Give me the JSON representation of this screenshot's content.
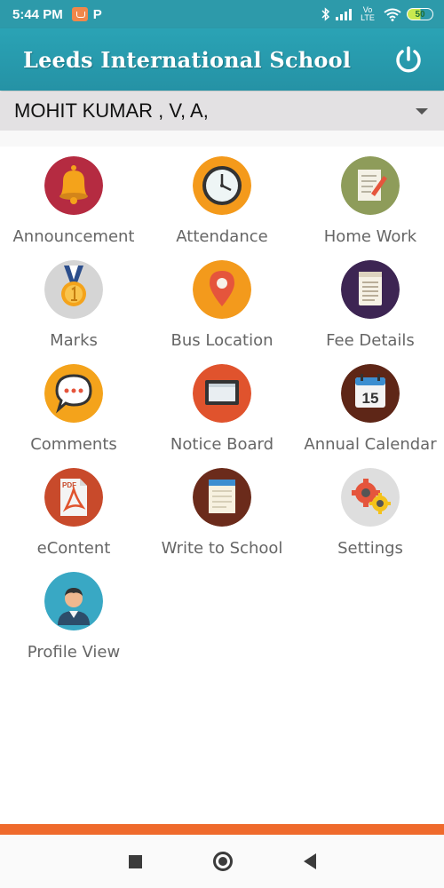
{
  "status_bar": {
    "time": "5:44 PM",
    "app_badge": "P",
    "network": "Vo LTE",
    "battery": "50"
  },
  "header": {
    "title": "Leeds International School",
    "power_icon": "power-icon",
    "background_color": "#2aa3b5"
  },
  "student": {
    "name": "MOHIT KUMAR , V, A,"
  },
  "menu": [
    {
      "label": "Announcement",
      "icon": "bell-icon",
      "color": "#b52b41"
    },
    {
      "label": "Attendance",
      "icon": "clock-icon",
      "color": "#f49a1b"
    },
    {
      "label": "Home Work",
      "icon": "notepad-icon",
      "color": "#8e9c5a"
    },
    {
      "label": "Marks",
      "icon": "medal-icon",
      "color": "#d5d5d5"
    },
    {
      "label": "Bus Location",
      "icon": "map-pin-icon",
      "color": "#f39a1c"
    },
    {
      "label": "Fee Details",
      "icon": "document-icon",
      "color": "#3d2553"
    },
    {
      "label": "Comments",
      "icon": "speech-bubble-icon",
      "color": "#f4a31b"
    },
    {
      "label": "Notice Board",
      "icon": "board-icon",
      "color": "#e0532d"
    },
    {
      "label": "Annual Calendar",
      "icon": "calendar-icon",
      "color": "#5e2617",
      "calendar_day": "15"
    },
    {
      "label": "eContent",
      "icon": "pdf-icon",
      "color": "#c84a2b",
      "pdf_text": "PDF"
    },
    {
      "label": "Write to School",
      "icon": "write-notepad-icon",
      "color": "#6b2b1b"
    },
    {
      "label": "Settings",
      "icon": "gears-icon",
      "color": "#dedede"
    },
    {
      "label": "Profile View",
      "icon": "user-icon",
      "color": "#39a8c4"
    }
  ],
  "navigation": {
    "recent": "square-icon",
    "home": "circle-icon",
    "back": "back-triangle-icon"
  }
}
